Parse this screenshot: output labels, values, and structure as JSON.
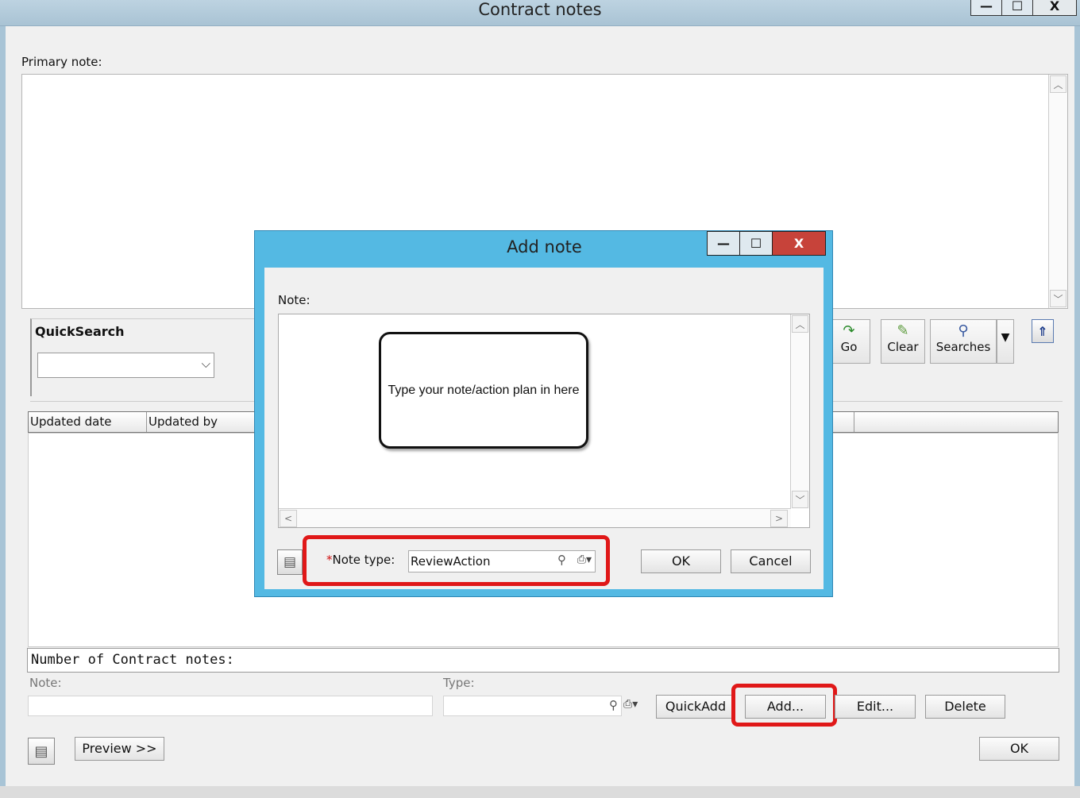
{
  "window": {
    "title": "Contract notes",
    "minimize": "—",
    "maximize": "☐",
    "close": "X"
  },
  "primary_note": {
    "label": "Primary note:"
  },
  "quicksearch": {
    "title": "QuickSearch",
    "value": ""
  },
  "toolbar": {
    "go_label": "Go",
    "clear_label": "Clear",
    "searches_label": "Searches"
  },
  "grid": {
    "columns": [
      "Updated date",
      "Updated by"
    ]
  },
  "count": {
    "label": "Number of Contract notes:"
  },
  "filters": {
    "note_label": "Note:",
    "type_label": "Type:"
  },
  "actions": {
    "quickadd": "QuickAdd",
    "add": "Add...",
    "edit": "Edit...",
    "delete": "Delete",
    "preview": "Preview >>",
    "ok": "OK"
  },
  "dialog": {
    "title": "Add note",
    "note_label": "Note:",
    "callout_text": "Type your note/action plan in here",
    "note_type_required": "*",
    "note_type_label": "Note type:",
    "note_type_value": "ReviewAction",
    "ok": "OK",
    "cancel": "Cancel"
  },
  "colors": {
    "dialog_frame": "#54b9e3",
    "highlight": "#e01818",
    "close_button": "#c7433a"
  }
}
